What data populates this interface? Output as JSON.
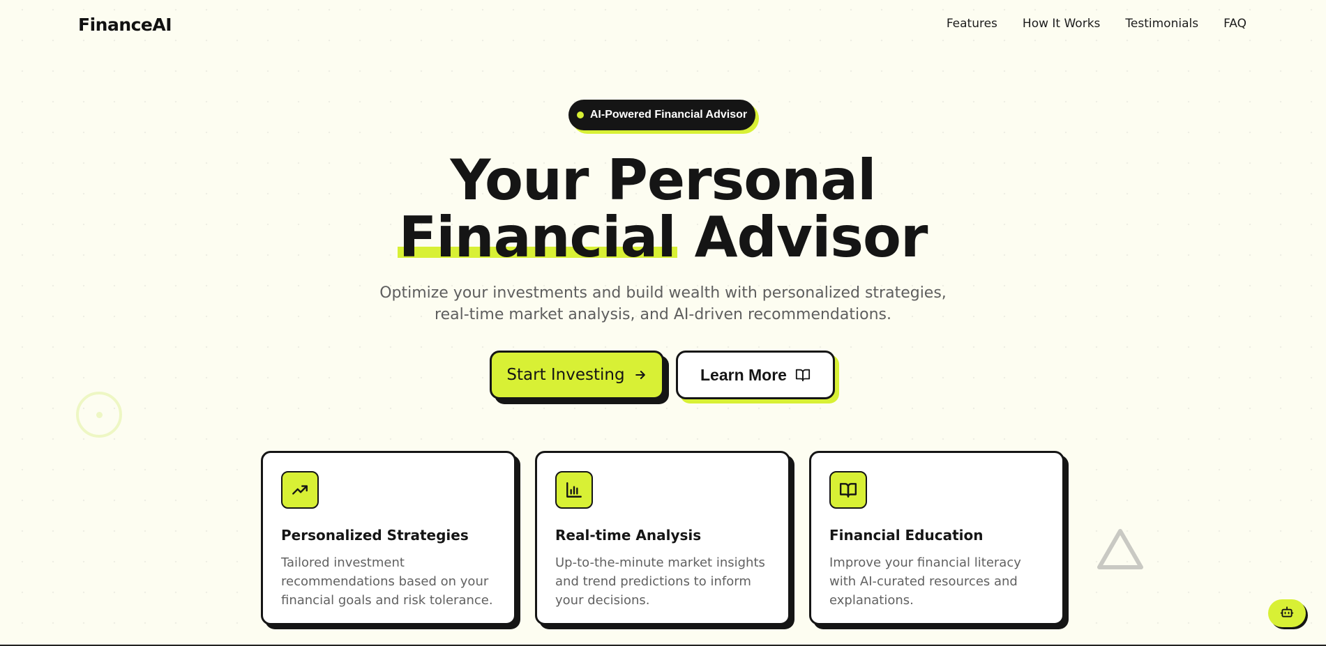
{
  "nav": {
    "logo": "FinanceAI",
    "links": [
      "Features",
      "How It Works",
      "Testimonials",
      "FAQ"
    ]
  },
  "hero": {
    "badge": "AI-Powered Financial Advisor",
    "title_line1": "Your Personal",
    "title_highlight": "Financial",
    "title_rest": "Advisor",
    "subtitle_line1": "Optimize your investments and build wealth with personalized strategies,",
    "subtitle_line2": "real-time market analysis, and AI-driven recommendations.",
    "primary_cta": "Start Investing",
    "secondary_cta": "Learn More"
  },
  "features": [
    {
      "icon": "trending-up-icon",
      "title": "Personalized Strategies",
      "text": "Tailored investment recommendations based on your financial goals and risk tolerance."
    },
    {
      "icon": "bar-chart-icon",
      "title": "Real-time Analysis",
      "text": "Up-to-the-minute market insights and trend predictions to inform your decisions."
    },
    {
      "icon": "book-open-icon",
      "title": "Financial Education",
      "text": "Improve your financial literacy with AI-curated resources and explanations."
    }
  ],
  "colors": {
    "accent": "#d8f035",
    "ink": "#151515",
    "background": "#fdfdf1"
  }
}
